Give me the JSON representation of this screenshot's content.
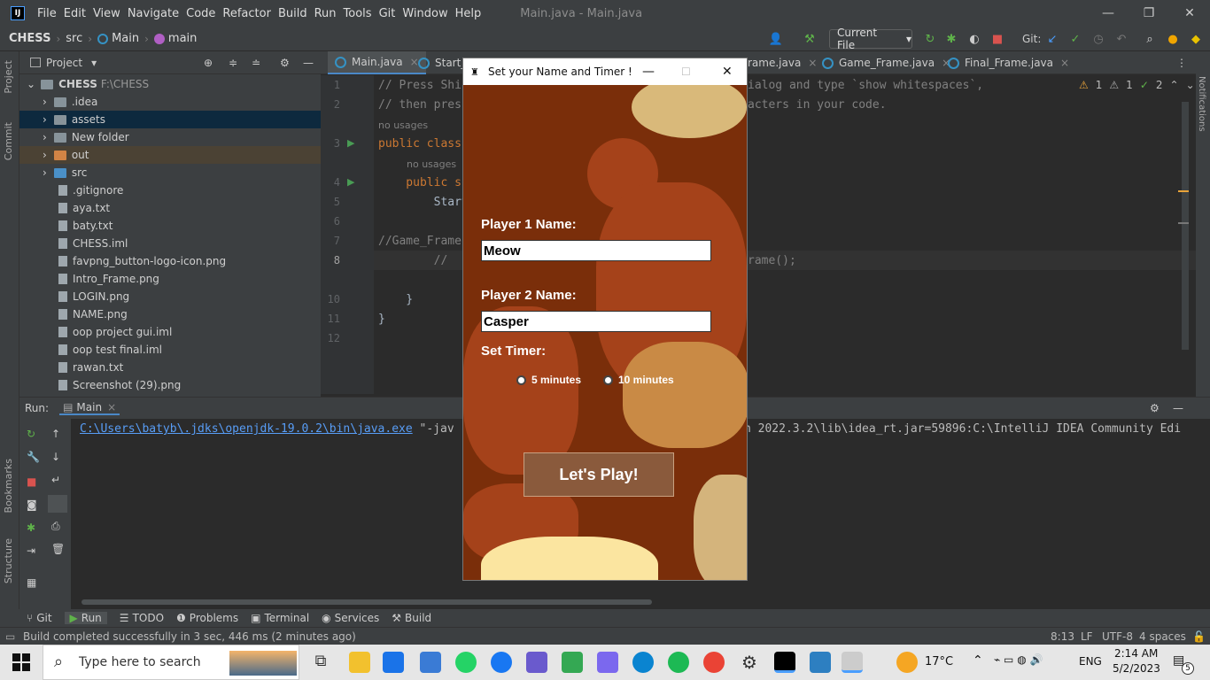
{
  "menubar": {
    "logo": "IJ",
    "items": [
      "File",
      "Edit",
      "View",
      "Navigate",
      "Code",
      "Refactor",
      "Build",
      "Run",
      "Tools",
      "Git",
      "Window",
      "Help"
    ],
    "title": "Main.java - Main.java"
  },
  "navbar": {
    "project": "CHESS",
    "crumb1": "src",
    "crumb2": "Main",
    "crumb3": "main",
    "run_config": "Current File",
    "git_label": "Git:"
  },
  "left_strip": {
    "project": "Project",
    "commit": "Commit",
    "bookmarks": "Bookmarks",
    "structure": "Structure"
  },
  "project_panel": {
    "title": "Project",
    "root": "CHESS",
    "root_path": "F:\\CHESS",
    "items": [
      ".idea",
      "assets",
      "New folder",
      "out",
      "src",
      ".gitignore",
      "aya.txt",
      "baty.txt",
      "CHESS.iml",
      "favpng_button-logo-icon.png",
      "Intro_Frame.png",
      "LOGIN.png",
      "NAME.png",
      "oop project gui.iml",
      "oop test final.iml",
      "rawan.txt",
      "Screenshot (29).png"
    ]
  },
  "editor_tabs": [
    "Main.java",
    "Start_",
    "rame.java",
    "Game_Frame.java",
    "Final_Frame.java"
  ],
  "inspections": {
    "warn1": "1",
    "warn2": "1",
    "ok": "2"
  },
  "code": {
    "line_numbers": [
      "1",
      "2",
      "3",
      "4",
      "5",
      "6",
      "7",
      "8",
      "10",
      "11",
      "12"
    ],
    "l1": "// Press Shi",
    "l1b": "ialog and type `show whitespaces`,",
    "l2": "// then pres",
    "l2b": "acters in your code.",
    "usage1": "no usages",
    "l3": "public class",
    "usage2": "no usages",
    "l4": "    public s",
    "l5": "        Start",
    "l7": "//Game_Frame",
    "l8": "        //",
    "l8b": "rame();",
    "l10": "    }",
    "l11": "}"
  },
  "run_panel": {
    "label": "Run:",
    "tab": "Main",
    "console_link": "C:\\Users\\batyb\\.jdks\\openjdk-19.0.2\\bin\\java.exe",
    "console_arg": " \"-jav",
    "console_rest": "n 2022.3.2\\lib\\idea_rt.jar=59896:C:\\IntelliJ IDEA Community Edi"
  },
  "tool_windows": [
    "Git",
    "Run",
    "TODO",
    "Problems",
    "Terminal",
    "Services",
    "Build"
  ],
  "status": {
    "message": "Build completed successfully in 3 sec, 446 ms (2 minutes ago)",
    "position": "8:13",
    "line_sep": "LF",
    "encoding": "UTF-8",
    "indent": "4 spaces"
  },
  "dialog": {
    "title": "Set your Name and Timer !",
    "player1_label": "Player 1 Name:",
    "player1_value": "Meow",
    "player2_label": "Player 2 Name:",
    "player2_value": "Casper",
    "timer_label": "Set Timer:",
    "option1": "5 minutes",
    "option2": "10 minutes",
    "play_button": "Let's Play!"
  },
  "taskbar": {
    "search_placeholder": "Type here to search",
    "weather": "17°C",
    "lang": "ENG",
    "time": "2:14 AM",
    "date": "5/2/2023",
    "notif": "5"
  },
  "colors": {
    "accent": "#3592c4",
    "dialog_bg": "#7a2e0a",
    "button": "#8a5a3c"
  }
}
